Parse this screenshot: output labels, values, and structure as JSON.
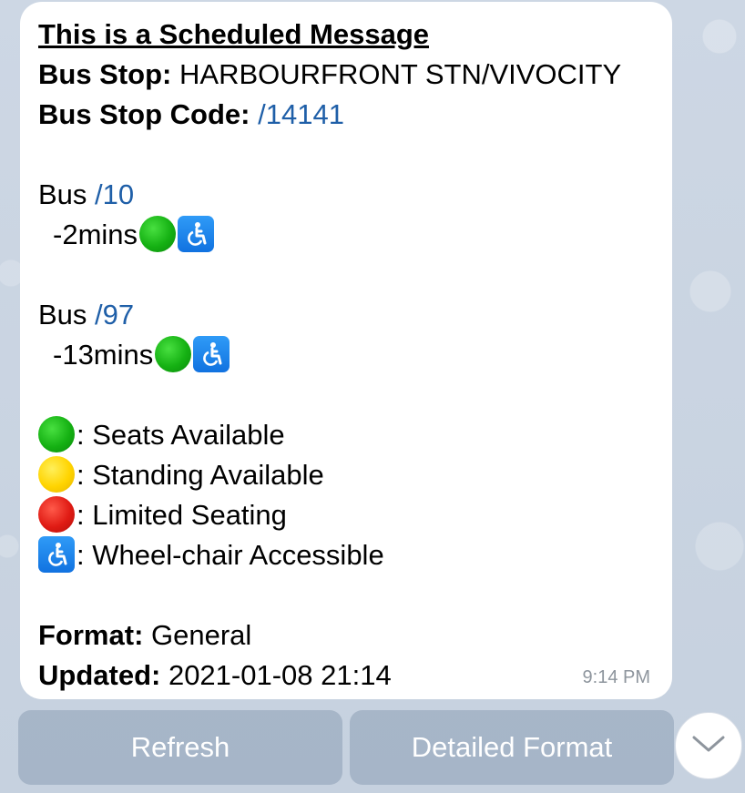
{
  "message": {
    "title": "This is a Scheduled Message",
    "bus_stop_label": "Bus Stop:",
    "bus_stop_value": "HARBOURFRONT STN/VIVOCITY",
    "bus_stop_code_label": "Bus Stop Code:",
    "bus_stop_code_value": "/14141",
    "buses": [
      {
        "label": "Bus",
        "number": "/10",
        "arrival": "-2mins",
        "load_status": "seats-available",
        "wheelchair_accessible": true
      },
      {
        "label": "Bus",
        "number": "/97",
        "arrival": "-13mins",
        "load_status": "seats-available",
        "wheelchair_accessible": true
      }
    ],
    "legend": [
      {
        "icon": "green-circle-icon",
        "color": "#15b113",
        "text": ": Seats Available"
      },
      {
        "icon": "yellow-circle-icon",
        "color": "#ffd400",
        "text": ": Standing Available"
      },
      {
        "icon": "red-circle-icon",
        "color": "#e01b14",
        "text": ": Limited Seating"
      },
      {
        "icon": "wheelchair-icon",
        "color": "#1172e0",
        "text": ": Wheel-chair Accessible"
      }
    ],
    "format_label": "Format:",
    "format_value": "General",
    "updated_label": "Updated:",
    "updated_value": "2021-01-08 21:14",
    "sent_time": "9:14 PM"
  },
  "buttons": {
    "refresh": "Refresh",
    "detailed_format": "Detailed Format",
    "scroll_down_icon": "chevron-down-icon"
  }
}
